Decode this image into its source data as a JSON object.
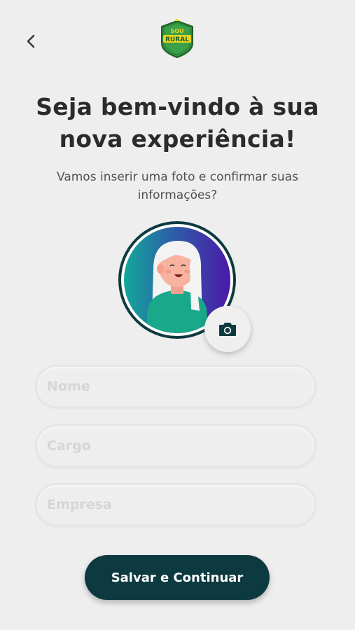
{
  "header": {
    "back_icon": "chevron-left-icon",
    "logo": {
      "line1": "SOU",
      "line2": "RURAL"
    }
  },
  "welcome": {
    "title_line1": "Seja bem-vindo à sua",
    "title_line2": "nova experiência!",
    "subtitle": "Vamos inserir uma foto e confirmar suas informações?"
  },
  "avatar": {
    "camera_icon": "camera-icon"
  },
  "form": {
    "name_placeholder": "Nome",
    "role_placeholder": "Cargo",
    "company_placeholder": "Empresa"
  },
  "actions": {
    "submit_label": "Salvar e Continuar"
  },
  "colors": {
    "primary": "#0c3a40",
    "logo_green": "#2f8c3a",
    "logo_yellow": "#e7d51a",
    "avatar_gradient_start": "#12a89a",
    "avatar_gradient_end": "#4a1aa8"
  }
}
